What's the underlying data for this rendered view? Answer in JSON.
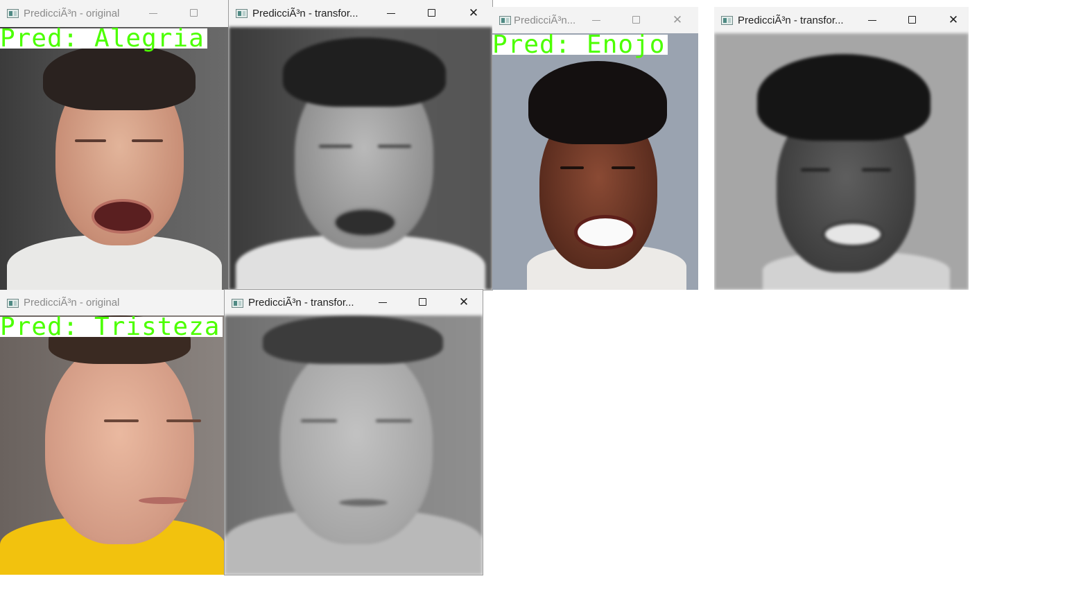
{
  "windows": [
    {
      "title": "PredicciÃ³n - original",
      "prediction": "Pred: Alegria"
    },
    {
      "title": "PredicciÃ³n - transfor..."
    },
    {
      "title": "PredicciÃ³n...",
      "prediction": "Pred: Enojo"
    },
    {
      "title": "PredicciÃ³n - transfor..."
    },
    {
      "title": "PredicciÃ³n - original",
      "prediction": "Pred: Tristeza"
    },
    {
      "title": "PredicciÃ³n - transfor..."
    }
  ],
  "icons": {
    "app": "opencv-window-icon",
    "minimize": "minimize-icon",
    "maximize": "maximize-icon",
    "close": "close-icon"
  },
  "colors": {
    "prediction_text": "#4cff00",
    "label_background": "#ffffff",
    "titlebar": "#f3f3f3"
  }
}
